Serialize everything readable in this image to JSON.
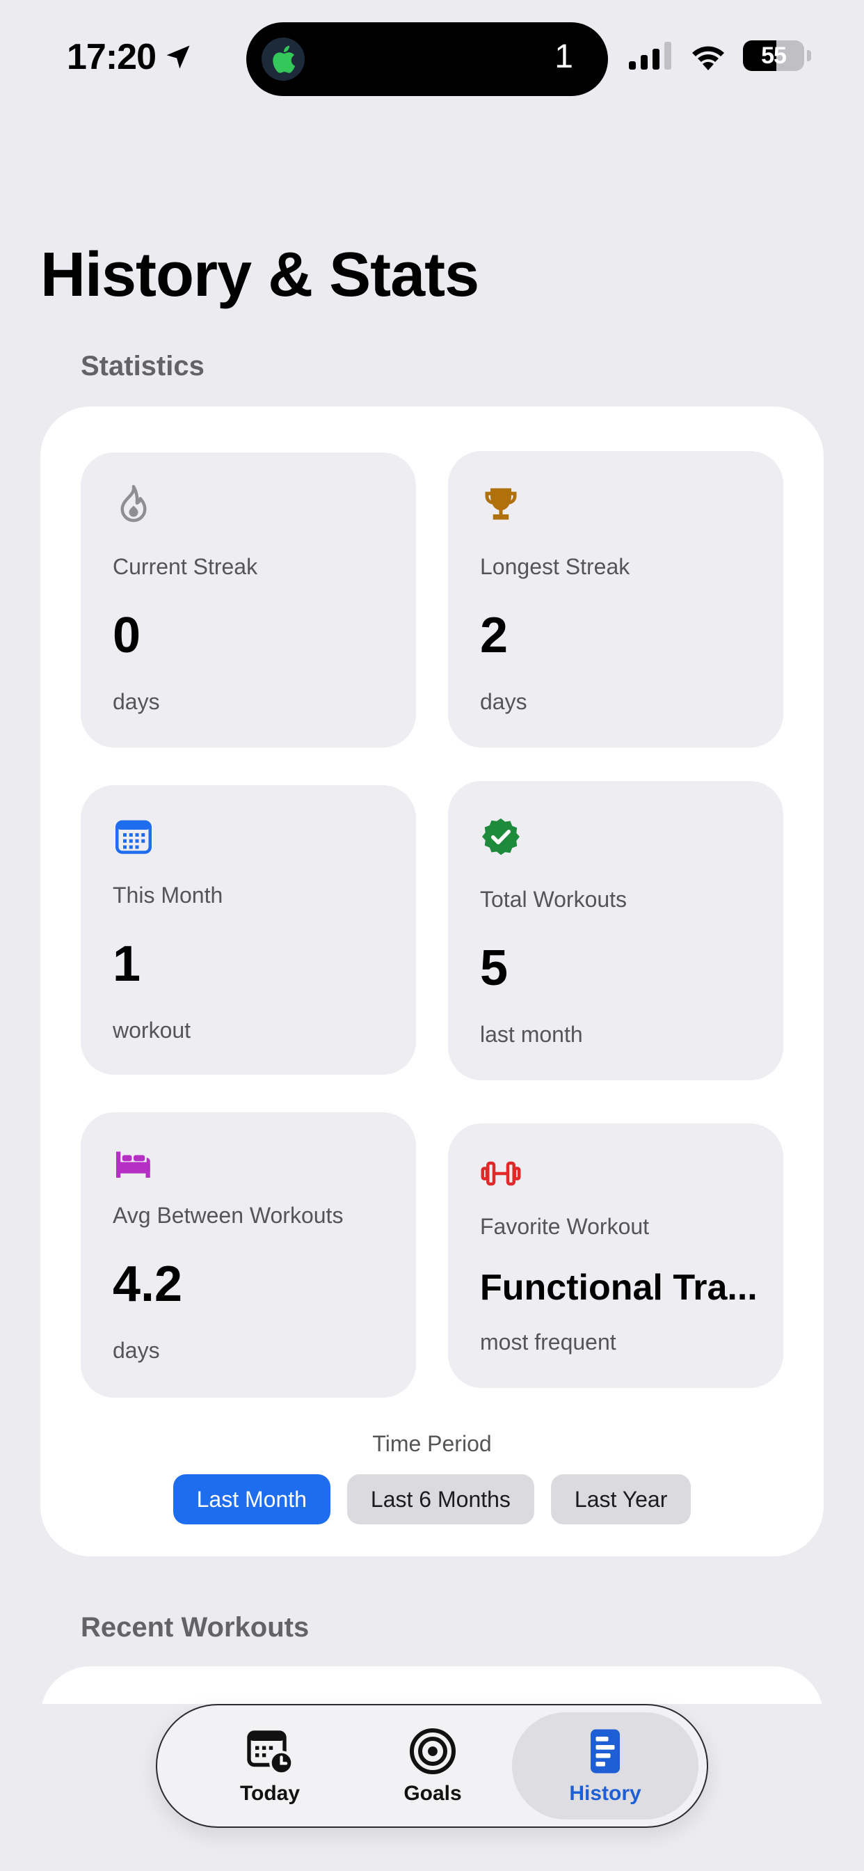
{
  "status_bar": {
    "time": "17:20",
    "island_count": "1",
    "battery_level": "55"
  },
  "page": {
    "title": "History & Stats",
    "statistics_header": "Statistics",
    "recent_header": "Recent Workouts"
  },
  "stats": {
    "current_streak": {
      "label": "Current Streak",
      "value": "0",
      "unit": "days",
      "icon": "flame-icon",
      "color": "#8E8E93"
    },
    "longest_streak": {
      "label": "Longest Streak",
      "value": "2",
      "unit": "days",
      "icon": "trophy-icon",
      "color": "#B0700C"
    },
    "this_month": {
      "label": "This Month",
      "value": "1",
      "unit": "workout",
      "icon": "calendar-icon",
      "color": "#1F6DEF"
    },
    "total_workouts": {
      "label": "Total Workouts",
      "value": "5",
      "unit": "last month",
      "icon": "checkmark-seal-icon",
      "color": "#1E8A3C"
    },
    "avg_between": {
      "label": "Avg Between Workouts",
      "value": "4.2",
      "unit": "days",
      "icon": "bed-icon",
      "color": "#B52FC4"
    },
    "favorite_workout": {
      "label": "Favorite Workout",
      "value": "Functional Tra...",
      "unit": "most frequent",
      "icon": "dumbbell-icon",
      "color": "#E02A2A"
    }
  },
  "time_period": {
    "label": "Time Period",
    "options": [
      "Last Month",
      "Last 6 Months",
      "Last Year"
    ],
    "selected": "Last Month"
  },
  "tab_bar": {
    "tabs": [
      {
        "label": "Today",
        "icon": "calendar-clock-icon"
      },
      {
        "label": "Goals",
        "icon": "target-icon"
      },
      {
        "label": "History",
        "icon": "history-list-icon"
      }
    ],
    "selected": "History",
    "accent": "#1F5FD6"
  }
}
